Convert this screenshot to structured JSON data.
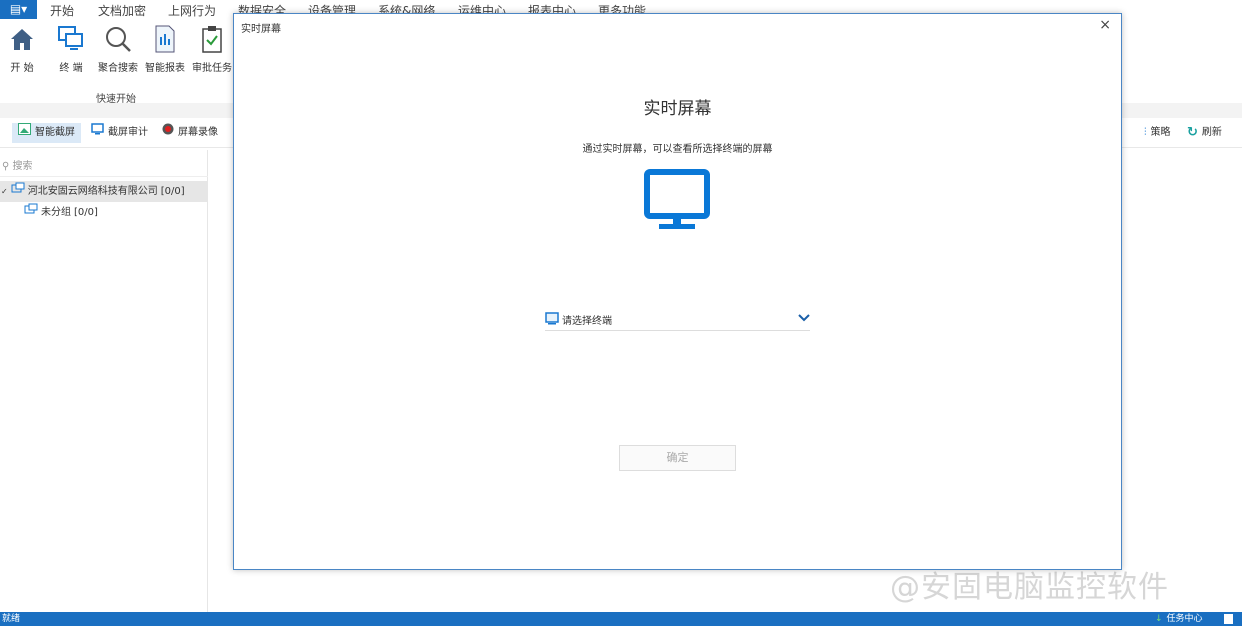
{
  "menu": {
    "items": [
      "开始",
      "文档加密",
      "上网行为",
      "数据安全",
      "设备管理",
      "系统&网络",
      "运维中心",
      "报表中心",
      "更多功能"
    ]
  },
  "ribbon": {
    "buttons": [
      "开 始",
      "终 端",
      "聚合搜索",
      "智能报表",
      "审批任务"
    ],
    "group": "快速开始"
  },
  "toolbar": {
    "left": [
      "智能截屏",
      "截屏审计",
      "屏幕录像"
    ],
    "right": [
      "策略",
      "刷新"
    ]
  },
  "sidebar": {
    "search_placeholder": "搜索",
    "tree": [
      {
        "label": "河北安固云网络科技有限公司",
        "count": "[0/0]"
      },
      {
        "label": "未分组",
        "count": "[0/0]"
      }
    ]
  },
  "dialog": {
    "title": "实时屏幕",
    "heading": "实时屏幕",
    "subtitle": "通过实时屏幕，可以查看所选择终端的屏幕",
    "select_placeholder": "请选择终端",
    "ok": "确定",
    "close": "×"
  },
  "status": {
    "left": "就绪",
    "right": "任务中心"
  },
  "watermark": "@安固电脑监控软件",
  "colors": {
    "accent": "#1a6fc1",
    "monitor": "#0a78d7"
  }
}
